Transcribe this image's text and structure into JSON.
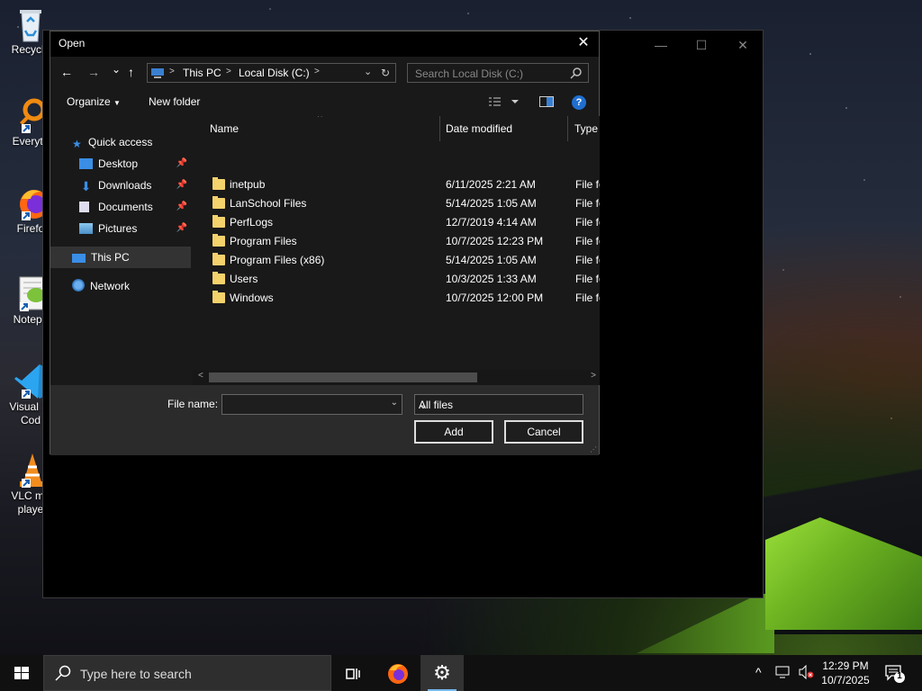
{
  "desktop": {
    "icons": [
      {
        "label": "Recycle",
        "icon": "recycle-bin-icon"
      },
      {
        "label": "Everyth",
        "icon": "everything-search-icon"
      },
      {
        "label": "Firefo",
        "icon": "firefox-icon"
      },
      {
        "label": "Notepa",
        "icon": "notepad-plus-icon"
      },
      {
        "label": "Visual St",
        "label2": "Cod",
        "icon": "vscode-icon"
      },
      {
        "label": "VLC me",
        "label2": "playe",
        "icon": "vlc-icon"
      }
    ]
  },
  "background_window": {
    "controls": {
      "minimize": "—",
      "maximize": "☐",
      "close": "✕"
    }
  },
  "dialog": {
    "title": "Open",
    "close": "✕",
    "nav": {
      "back": "←",
      "forward": "→",
      "recent": "⌄",
      "up": "↑",
      "breadcrumb": [
        "This PC",
        "Local Disk (C:)"
      ],
      "separator": ">",
      "refresh": "↻",
      "search_placeholder": "Search Local Disk (C:)"
    },
    "toolbar": {
      "organize": "Organize",
      "new_folder": "New folder",
      "help": "?"
    },
    "nav_pane": {
      "quick_access": "Quick access",
      "pinned": [
        {
          "label": "Desktop",
          "icon": "desktop-icon"
        },
        {
          "label": "Downloads",
          "icon": "downloads-icon"
        },
        {
          "label": "Documents",
          "icon": "documents-icon"
        },
        {
          "label": "Pictures",
          "icon": "pictures-icon"
        }
      ],
      "this_pc": "This PC",
      "network": "Network"
    },
    "columns": {
      "name": "Name",
      "date": "Date modified",
      "type": "Type"
    },
    "files": [
      {
        "name": "inetpub",
        "date": "6/11/2025 2:21 AM",
        "type": "File fo"
      },
      {
        "name": "LanSchool Files",
        "date": "5/14/2025 1:05 AM",
        "type": "File fo"
      },
      {
        "name": "PerfLogs",
        "date": "12/7/2019 4:14 AM",
        "type": "File fo"
      },
      {
        "name": "Program Files",
        "date": "10/7/2025 12:23 PM",
        "type": "File fo"
      },
      {
        "name": "Program Files (x86)",
        "date": "5/14/2025 1:05 AM",
        "type": "File fo"
      },
      {
        "name": "Users",
        "date": "10/3/2025 1:33 AM",
        "type": "File fo"
      },
      {
        "name": "Windows",
        "date": "10/7/2025 12:00 PM",
        "type": "File fo"
      }
    ],
    "bottom": {
      "file_name_label": "File name:",
      "file_name_value": "",
      "filter": "All files",
      "add": "Add",
      "cancel": "Cancel"
    }
  },
  "taskbar": {
    "search_placeholder": "Type here to search",
    "time": "12:29 PM",
    "date": "10/7/2025",
    "notification_count": "1"
  }
}
